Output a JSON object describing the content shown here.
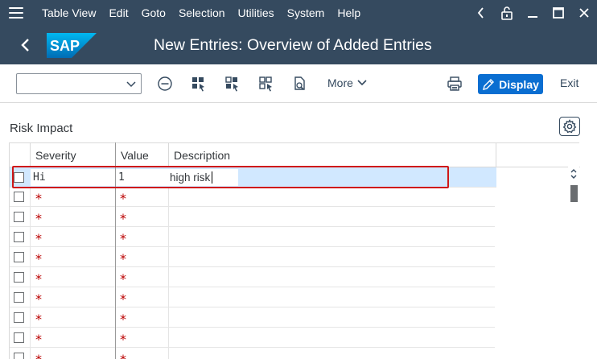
{
  "menubar": {
    "items": [
      "Table View",
      "Edit",
      "Goto",
      "Selection",
      "Utilities",
      "System",
      "Help"
    ]
  },
  "titlebar": {
    "logo_text": "SAP",
    "title": "New Entries: Overview of Added Entries"
  },
  "toolbar": {
    "command_field_value": "",
    "more_label": "More",
    "display_label": "Display",
    "exit_label": "Exit"
  },
  "section": {
    "title": "Risk Impact"
  },
  "table": {
    "columns": [
      "Severity",
      "Value",
      "Description"
    ],
    "first_row": {
      "severity": "Hi",
      "value": "1",
      "description": "high risk"
    },
    "required_marker": "*"
  },
  "colors": {
    "shell": "#354a5f",
    "accent": "#0a6ed1",
    "selection": "#d1e8ff",
    "required": "#bb0000",
    "highlight": "#d01818"
  }
}
